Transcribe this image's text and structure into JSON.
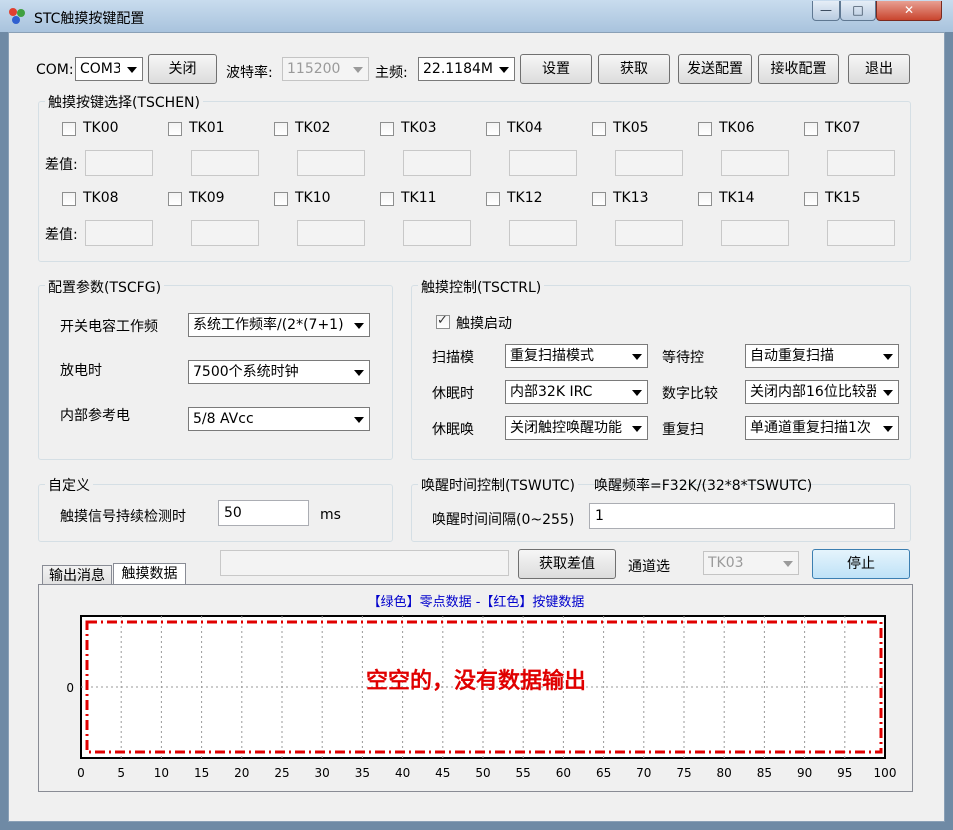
{
  "window": {
    "title": "STC触摸按键配置"
  },
  "colors": {
    "legend": "#0000cc",
    "annotation": "#e00000",
    "dash_border": "#e00000"
  },
  "toolbar": {
    "com_label": "COM:",
    "com_value": "COM3",
    "close_port": "关闭",
    "baud_label": "波特率:",
    "baud_value": "115200",
    "freq_label": "主频:",
    "freq_value": "22.1184MI",
    "settings": "设置",
    "get": "获取",
    "send_config": "发送配置",
    "recv_config": "接收配置",
    "exit": "退出"
  },
  "tschen": {
    "title": "触摸按键选择(TSCHEN)",
    "diff_label": "差值:",
    "keys": [
      "TK00",
      "TK01",
      "TK02",
      "TK03",
      "TK04",
      "TK05",
      "TK06",
      "TK07",
      "TK08",
      "TK09",
      "TK10",
      "TK11",
      "TK12",
      "TK13",
      "TK14",
      "TK15"
    ]
  },
  "tscfg": {
    "title": "配置参数(TSCFG)",
    "rows": [
      {
        "label": "开关电容工作频",
        "value": "系统工作频率/(2*(7+1)"
      },
      {
        "label": "放电时",
        "value": "7500个系统时钟"
      },
      {
        "label": "内部参考电",
        "value": "5/8 AVcc"
      }
    ]
  },
  "tsctrl": {
    "title": "触摸控制(TSCTRL)",
    "enable_label": "触摸启动",
    "enable_checked": true,
    "scan_mode_label": "扫描模",
    "scan_mode_value": "重复扫描模式",
    "wait_label": "等待控",
    "wait_value": "自动重复扫描",
    "sleep_clk_label": "休眠时",
    "sleep_clk_value": "内部32K IRC",
    "compare_label": "数字比较",
    "compare_value": "关闭内部16位比较器",
    "wake_label": "休眠唤",
    "wake_value": "关闭触控唤醒功能",
    "repeat_label": "重复扫",
    "repeat_value": "单通道重复扫描1次"
  },
  "custom": {
    "title": "自定义",
    "detect_label": "触摸信号持续检测时",
    "detect_value": "50",
    "unit": "ms"
  },
  "tswutc": {
    "title": "唤醒时间控制(TSWUTC)",
    "formula": "唤醒频率=F32K/(32*8*TSWUTC)",
    "interval_label": "唤醒时间间隔(0~255)",
    "interval_value": "1"
  },
  "bottom": {
    "tab_output": "输出消息",
    "tab_touch": "触摸数据",
    "get_diff": "获取差值",
    "channel_label": "通道选",
    "channel_value": "TK03",
    "stop": "停止"
  },
  "chart_data": {
    "type": "line",
    "title": "【绿色】零点数据 -【红色】按键数据",
    "xlim": [
      0,
      100
    ],
    "x_ticks": [
      "0",
      "5",
      "10",
      "15",
      "20",
      "25",
      "30",
      "35",
      "40",
      "45",
      "50",
      "55",
      "60",
      "65",
      "70",
      "75",
      "80",
      "85",
      "90",
      "95",
      "100"
    ],
    "y_ticks": [
      "0"
    ],
    "grid": true,
    "series": [],
    "annotation": "空空的，没有数据输出"
  }
}
